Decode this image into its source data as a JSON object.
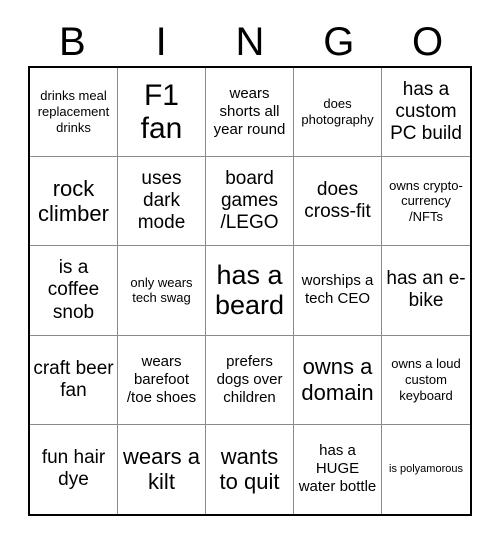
{
  "card": {
    "title": "BINGO",
    "headers": [
      "B",
      "I",
      "N",
      "G",
      "O"
    ],
    "rows": [
      [
        {
          "text": "drinks meal replacement drinks",
          "size": "xs"
        },
        {
          "text": "F1 fan",
          "size": "xxl"
        },
        {
          "text": "wears shorts all year round",
          "size": "sm"
        },
        {
          "text": "does photography",
          "size": "xs"
        },
        {
          "text": "has a custom PC build",
          "size": "md"
        }
      ],
      [
        {
          "text": "rock climber",
          "size": "lg"
        },
        {
          "text": "uses dark mode",
          "size": "md"
        },
        {
          "text": "board games /LEGO",
          "size": "md"
        },
        {
          "text": "does cross-fit",
          "size": "md"
        },
        {
          "text": "owns crypto-currency /NFTs",
          "size": "xs"
        }
      ],
      [
        {
          "text": "is a coffee snob",
          "size": "md"
        },
        {
          "text": "only wears tech swag",
          "size": "xs"
        },
        {
          "text": "has a beard",
          "size": "xl"
        },
        {
          "text": "worships a tech CEO",
          "size": "sm"
        },
        {
          "text": "has an e-bike",
          "size": "md"
        }
      ],
      [
        {
          "text": "craft beer fan",
          "size": "md"
        },
        {
          "text": "wears barefoot /toe shoes",
          "size": "sm"
        },
        {
          "text": "prefers dogs over children",
          "size": "sm"
        },
        {
          "text": "owns a domain",
          "size": "lg"
        },
        {
          "text": "owns a loud custom keyboard",
          "size": "xs"
        }
      ],
      [
        {
          "text": "fun hair dye",
          "size": "md"
        },
        {
          "text": "wears a kilt",
          "size": "lg"
        },
        {
          "text": "wants to quit",
          "size": "lg"
        },
        {
          "text": "has a HUGE water bottle",
          "size": "sm"
        },
        {
          "text": "is polyamorous",
          "size": "xxs"
        }
      ]
    ]
  },
  "colors": {
    "background": "#ffffff",
    "text": "#000000",
    "outer_border": "#000000",
    "inner_border": "#8a8a8a"
  }
}
